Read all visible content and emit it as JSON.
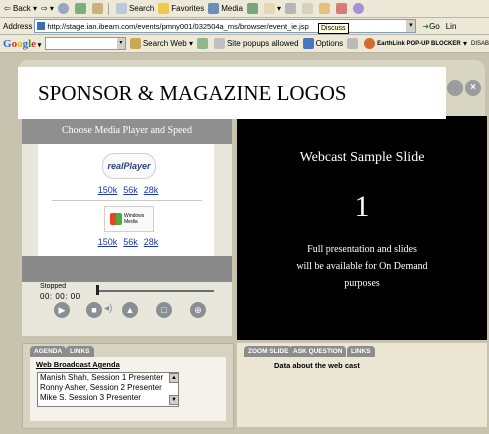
{
  "toolbar": {
    "back": "Back",
    "search": "Search",
    "favorites": "Favorites",
    "media": "Media"
  },
  "address": {
    "label": "Address",
    "url": "http://stage.ian.ibeam.com/events/pmny001/032504a_ms/browser/event_ie.jsp",
    "tooltip": "Discuss",
    "go": "Go",
    "links": "Lin"
  },
  "google": {
    "logo": "Google",
    "search_web": "Search Web",
    "popups": "Site popups allowed",
    "options": "Options",
    "earthlink": "EarthLink POP-UP BLOCKER",
    "disable": "DISAB"
  },
  "banner": {
    "title": "SPONSOR  & MAGAZINE LOGOS"
  },
  "player": {
    "choose_label": "Choose Media Player and Speed",
    "realplayer_logo": "realPlayer",
    "real_speeds": [
      "150k",
      "56k",
      "28k"
    ],
    "wmp_logo": "Windows Media",
    "wmp_speeds": [
      "150k",
      "56k",
      "28k"
    ],
    "status": "Stopped",
    "time": "00: 00: 00",
    "progress": 0
  },
  "slide": {
    "title": "Webcast Sample Slide",
    "number": "1",
    "line1": "Full presentation and slides",
    "line2": "will be available for On Demand",
    "line3": "purposes"
  },
  "agenda_tabs": [
    "AGENDA",
    "LINKS"
  ],
  "agenda": {
    "heading": "Web Broadcast Agenda",
    "items": [
      "Manish Shah, Session 1 Presenter",
      "Ronny Asher, Session 2 Presenter",
      "Mike S. Session 3 Presenter"
    ]
  },
  "right_tabs": [
    "ZOOM SLIDE",
    "ASK QUESTION",
    "LINKS"
  ],
  "right_panel": {
    "text": "Data about the web cast"
  }
}
